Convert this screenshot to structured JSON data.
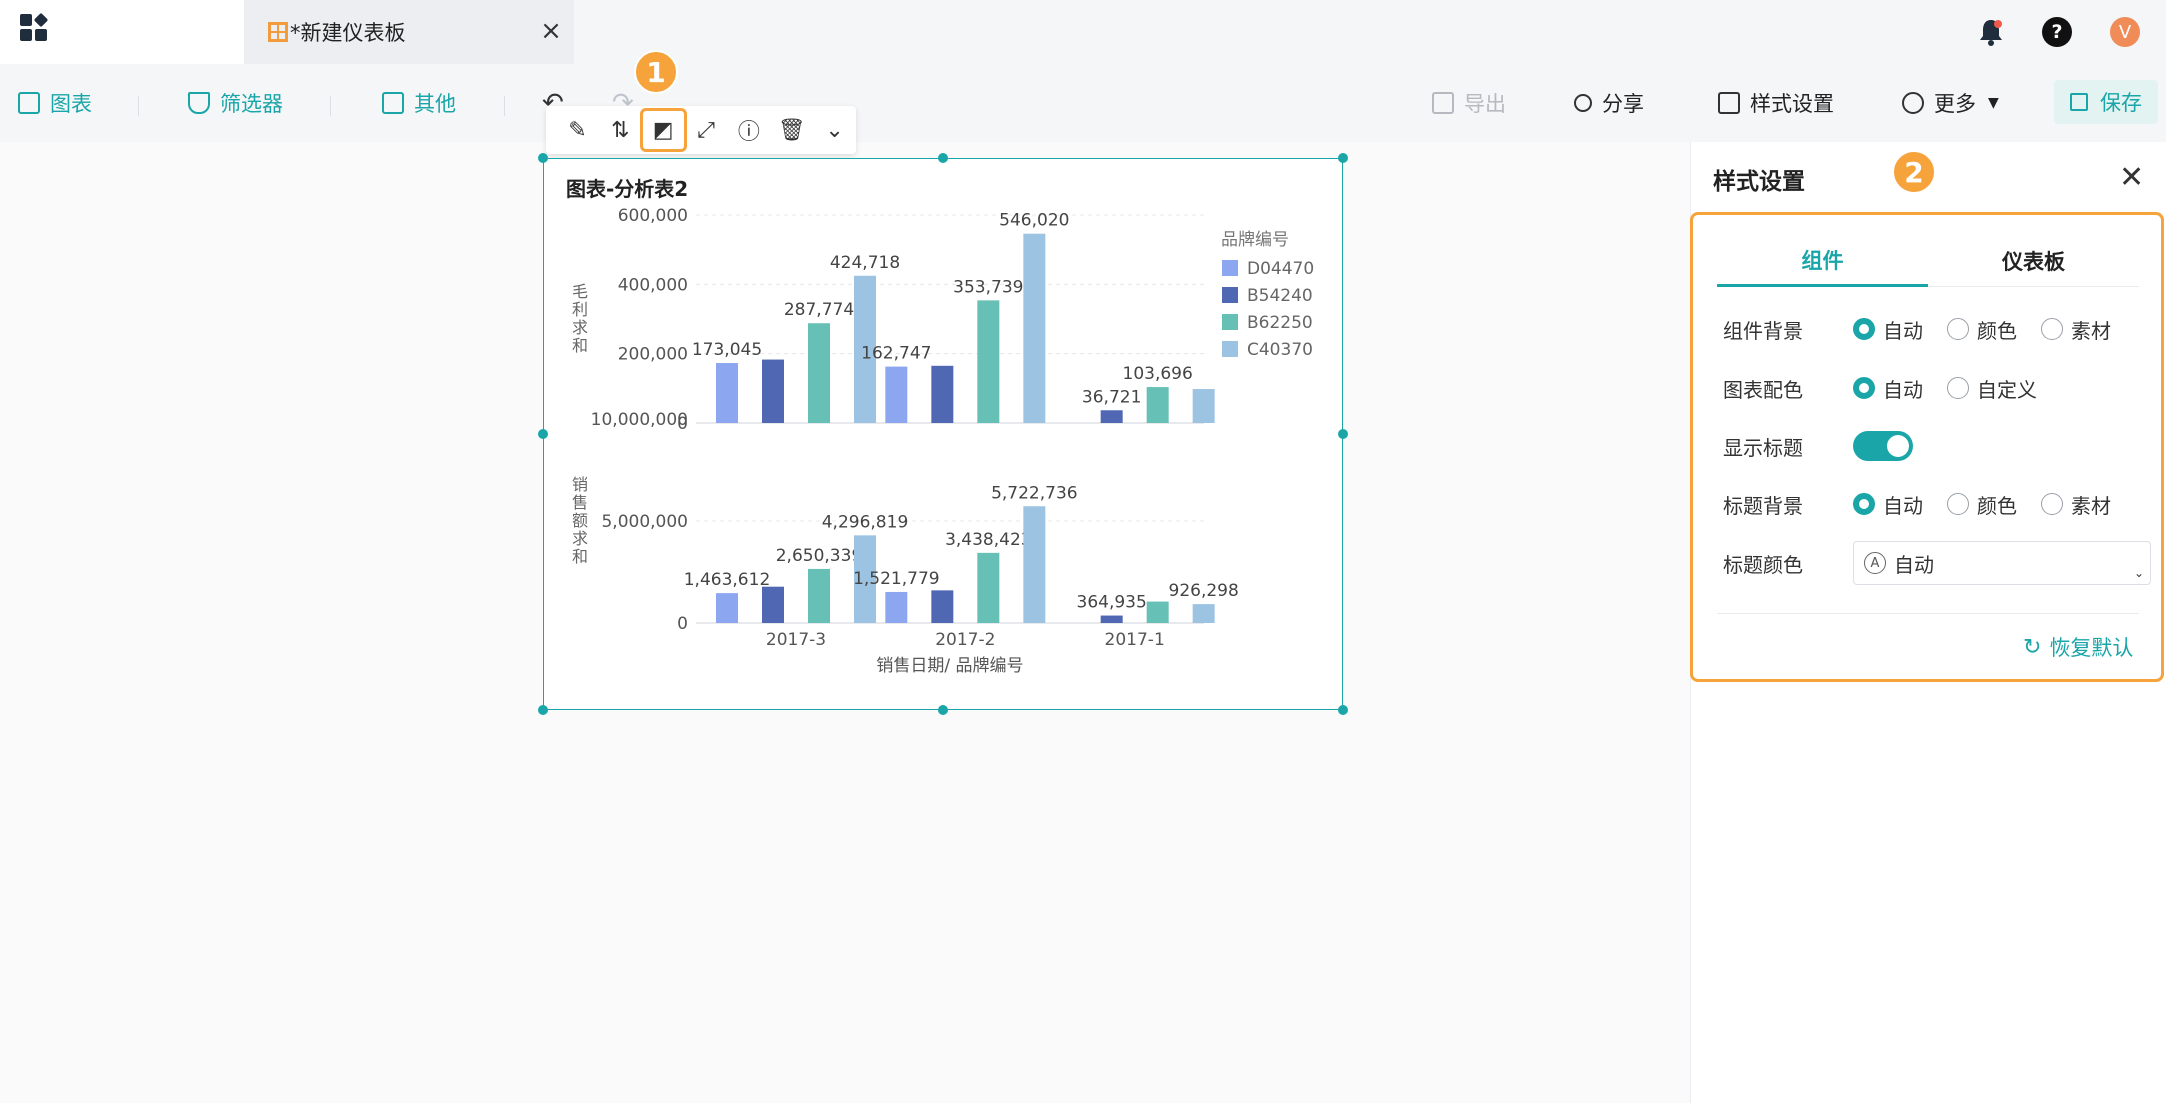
{
  "app": {
    "tab_title": "*新建仪表板",
    "tab_close": "×",
    "avatar_letter": "V",
    "help_glyph": "?"
  },
  "toolbar": {
    "chart_label": "图表",
    "filter_label": "筛选器",
    "other_label": "其他",
    "undo_glyph": "↶",
    "redo_glyph": "↷",
    "export_label": "导出",
    "share_label": "分享",
    "style_label": "样式设置",
    "more_label": "更多",
    "save_label": "保存"
  },
  "widget_tools": {
    "edit": "✎",
    "sort": "⇅",
    "style": "◩",
    "expand": "⤢",
    "info": "ⓘ",
    "delete": "🗑",
    "dropdown": "⌄"
  },
  "badges": {
    "first": "1",
    "second": "2"
  },
  "widget": {
    "title": "图表-分析表2"
  },
  "chart_data": {
    "type": "bar",
    "categories": [
      "2017-3",
      "2017-2",
      "2017-1"
    ],
    "legend_title": "品牌编号",
    "xlabel": "销售日期/ 品牌编号",
    "series": [
      {
        "name": "D04470",
        "color": "#8ca7f0"
      },
      {
        "name": "B54240",
        "color": "#5067b3"
      },
      {
        "name": "B62250",
        "color": "#66c0b6"
      },
      {
        "name": "C40370",
        "color": "#9dc3e2"
      }
    ],
    "panels": [
      {
        "ylabel": "毛利求和",
        "ylim": [
          0,
          600000
        ],
        "ticks": [
          0,
          200000,
          400000,
          600000
        ],
        "tick_labels": [
          "0",
          "200,000",
          "400,000",
          "600,000"
        ],
        "values": [
          [
            173045,
            183000,
            287774,
            424718
          ],
          [
            162747,
            165000,
            353739,
            546020
          ],
          [
            0,
            36721,
            103696,
            98000
          ]
        ],
        "value_labels": [
          [
            "173,045",
            "",
            "287,774",
            "424,718"
          ],
          [
            "162,747",
            "",
            "353,739",
            "546,020"
          ],
          [
            "",
            "36,721",
            "103,696",
            ""
          ]
        ]
      },
      {
        "ylabel": "销售额求和",
        "ylim": [
          0,
          10000000
        ],
        "ticks": [
          0,
          5000000,
          10000000
        ],
        "tick_labels": [
          "0",
          "5,000,000",
          "10,000,000"
        ],
        "values": [
          [
            1463612,
            1780000,
            2650339,
            4296819
          ],
          [
            1521779,
            1600000,
            3438423,
            5722736
          ],
          [
            0,
            364935,
            1050000,
            926298
          ]
        ],
        "value_labels": [
          [
            "1,463,612",
            "",
            "2,650,339",
            "4,296,819"
          ],
          [
            "1,521,779",
            "",
            "3,438,423",
            "5,722,736"
          ],
          [
            "",
            "364,935",
            "",
            "926,298"
          ]
        ]
      }
    ]
  },
  "panel": {
    "title": "样式设置",
    "close": "✕",
    "tabs": [
      "组件",
      "仪表板"
    ],
    "rows": {
      "component_bg": {
        "label": "组件背景",
        "options": [
          "自动",
          "颜色",
          "素材"
        ],
        "selected": "自动"
      },
      "chart_color": {
        "label": "图表配色",
        "options": [
          "自动",
          "自定义"
        ],
        "selected": "自动"
      },
      "show_title": {
        "label": "显示标题",
        "value": true
      },
      "title_bg": {
        "label": "标题背景",
        "options": [
          "自动",
          "颜色",
          "素材"
        ],
        "selected": "自动"
      },
      "title_color": {
        "label": "标题颜色",
        "value": "自动",
        "icon_letter": "A"
      }
    },
    "reset_label": "恢复默认",
    "accent": "#1aa6a8",
    "highlight": "#f5a33a"
  }
}
